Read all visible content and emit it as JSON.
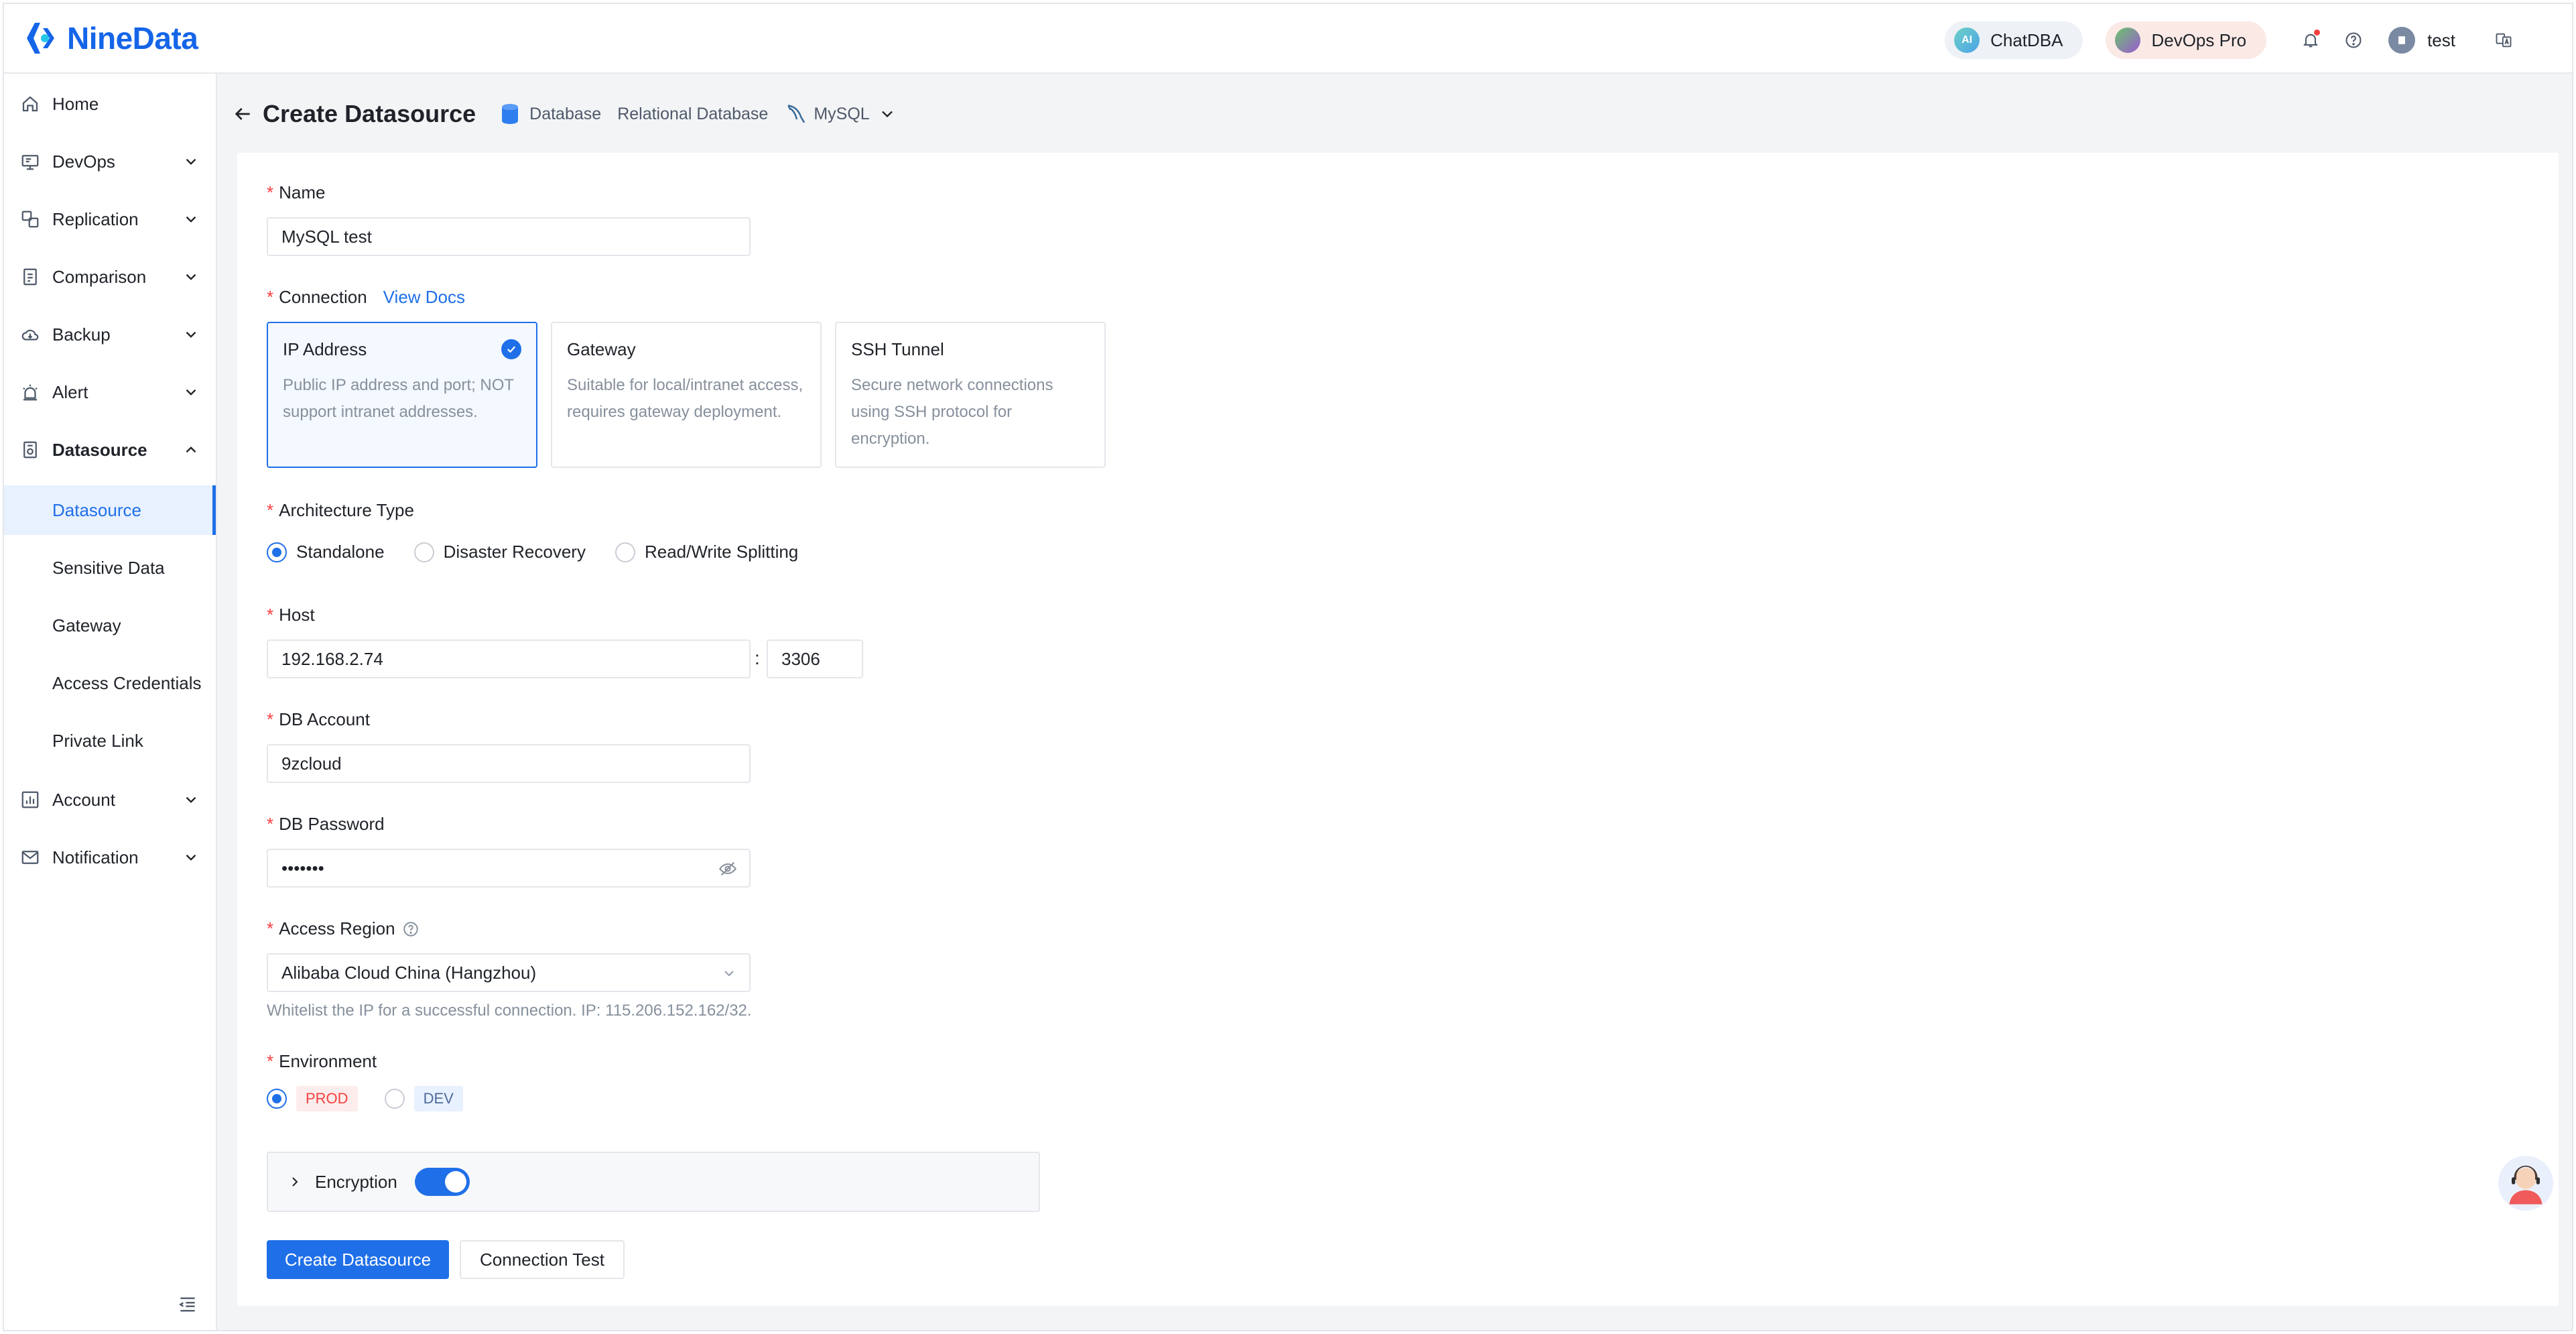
{
  "brand": {
    "name": "NineData"
  },
  "header": {
    "chatdba_label": "ChatDBA",
    "chatdba_badge": "AI",
    "devops_label": "DevOps Pro",
    "user_name": "test"
  },
  "sidebar": {
    "items": [
      {
        "label": "Home"
      },
      {
        "label": "DevOps"
      },
      {
        "label": "Replication"
      },
      {
        "label": "Comparison"
      },
      {
        "label": "Backup"
      },
      {
        "label": "Alert"
      },
      {
        "label": "Datasource"
      },
      {
        "label": "Account"
      },
      {
        "label": "Notification"
      }
    ],
    "datasource_sub": [
      {
        "label": "Datasource"
      },
      {
        "label": "Sensitive Data"
      },
      {
        "label": "Gateway"
      },
      {
        "label": "Access Credentials"
      },
      {
        "label": "Private Link"
      }
    ]
  },
  "page": {
    "title": "Create Datasource",
    "breadcrumb": [
      "Database",
      "Relational Database",
      "MySQL"
    ]
  },
  "form": {
    "name_label": "Name",
    "name_value": "MySQL test",
    "connection_label": "Connection",
    "view_docs": "View Docs",
    "connection_options": [
      {
        "title": "IP Address",
        "desc": "Public IP address and port; NOT support intranet addresses."
      },
      {
        "title": "Gateway",
        "desc": "Suitable for local/intranet access, requires gateway deployment."
      },
      {
        "title": "SSH Tunnel",
        "desc": "Secure network connections using SSH protocol for encryption."
      }
    ],
    "architecture_label": "Architecture Type",
    "architecture_options": [
      "Standalone",
      "Disaster Recovery",
      "Read/Write Splitting"
    ],
    "host_label": "Host",
    "host_value": "192.168.2.74",
    "host_separator": ":",
    "port_value": "3306",
    "account_label": "DB Account",
    "account_value": "9zcloud",
    "password_label": "DB Password",
    "password_value": "•••••••",
    "region_label": "Access Region",
    "region_value": "Alibaba Cloud China (Hangzhou)",
    "region_hint": "Whitelist the IP for a successful connection. IP: 115.206.152.162/32.",
    "environment_label": "Environment",
    "environment_options": [
      "PROD",
      "DEV"
    ],
    "encryption_label": "Encryption",
    "submit_label": "Create Datasource",
    "test_label": "Connection Test"
  },
  "colors": {
    "accent": "#1f6fe8",
    "required": "#f53f3f",
    "prod_tag": "#f53f3f"
  }
}
